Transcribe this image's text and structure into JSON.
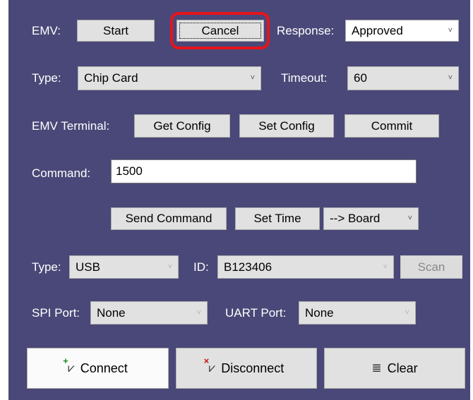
{
  "row1": {
    "emv_label": "EMV:",
    "start": "Start",
    "cancel": "Cancel",
    "response_label": "Response:",
    "response_value": "Approved"
  },
  "row2": {
    "type_label": "Type:",
    "type_value": "Chip Card",
    "timeout_label": "Timeout:",
    "timeout_value": "60"
  },
  "row3": {
    "terminal_label": "EMV Terminal:",
    "get_config": "Get Config",
    "set_config": "Set Config",
    "commit": "Commit"
  },
  "row4": {
    "command_label": "Command:",
    "command_value": "1500"
  },
  "row5": {
    "send_command": "Send Command",
    "set_time": "Set Time",
    "direction_value": "--> Board"
  },
  "row6": {
    "type_label": "Type:",
    "type_value": "USB",
    "id_label": "ID:",
    "id_value": "B123406",
    "scan": "Scan"
  },
  "row7": {
    "spi_label": "SPI Port:",
    "spi_value": "None",
    "uart_label": "UART Port:",
    "uart_value": "None"
  },
  "bottom": {
    "connect": "Connect",
    "disconnect": "Disconnect",
    "clear": "Clear"
  },
  "colors": {
    "panel": "#4a4878",
    "highlight": "#e8141c"
  },
  "icons": {
    "connect": "plug-plus-icon",
    "disconnect": "plug-x-icon",
    "clear": "clear-list-icon"
  }
}
